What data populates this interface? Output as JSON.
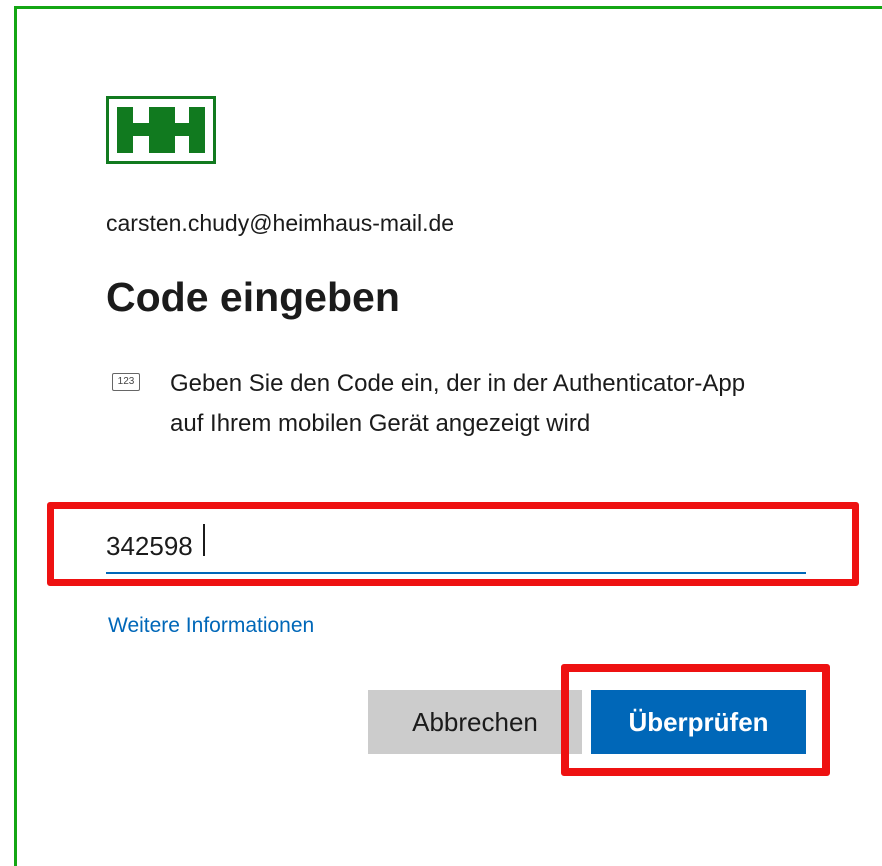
{
  "brand": {
    "logo_text": "HH",
    "logo_color": "#117a1f"
  },
  "account": {
    "email": "carsten.chudy@heimhaus-mail.de"
  },
  "dialog": {
    "title": "Code eingeben",
    "hint_icon_label": "123",
    "hint_icon_name": "numeric-code-icon",
    "hint_text": "Geben Sie den Code ein, der in der Authenticator-App auf Ihrem mobilen Gerät angezeigt wird",
    "code_value": "342598",
    "more_info_link": "Weitere Informationen"
  },
  "actions": {
    "cancel_label": "Abbrechen",
    "verify_label": "Überprüfen"
  },
  "colors": {
    "accent_blue": "#0067b8",
    "cancel_gray": "#cccccc",
    "annotation_red": "#ee1111",
    "frame_green": "#14a614"
  }
}
